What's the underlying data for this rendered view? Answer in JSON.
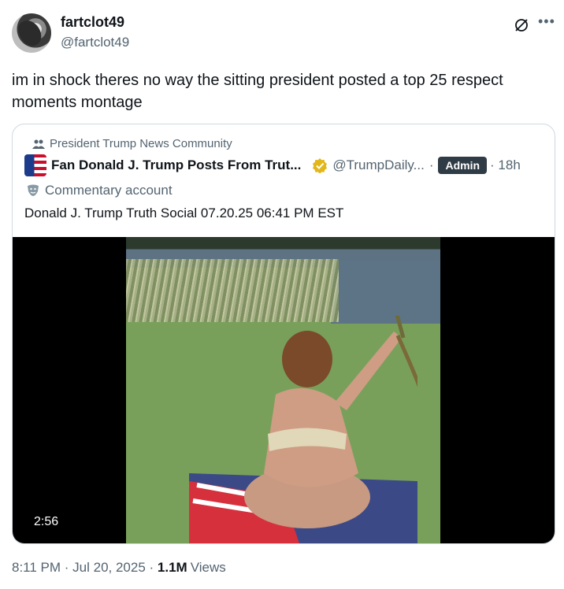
{
  "author": {
    "name": "fartclot49",
    "handle": "@fartclot49"
  },
  "tweet": {
    "text": "im in shock theres no way the sitting president posted a top 25 respect moments montage"
  },
  "icons": {
    "grok": "grok-icon",
    "more": "more-icon",
    "community": "community-icon",
    "verified": "verified-gold-icon",
    "commentary": "commentary-mask-icon"
  },
  "quote": {
    "community": "President Trump News Community",
    "name": "Fan Donald J. Trump Posts From Trut...",
    "handle": "@TrumpDaily...",
    "separator": "·",
    "badge": "Admin",
    "time": "· 18h",
    "commentary_label": "Commentary account",
    "text": "Donald J. Trump Truth Social 07.20.25 06:41 PM EST",
    "video_duration": "2:56"
  },
  "meta": {
    "timestamp": "8:11 PM · Jul 20, 2025 · ",
    "views_count": "1.1M",
    "views_label": "Views"
  },
  "colors": {
    "text": "#0f1419",
    "secondary": "#536471",
    "border": "#cfd9de",
    "badge_bg": "#2f3b45",
    "verified_gold": "#e2b719"
  }
}
